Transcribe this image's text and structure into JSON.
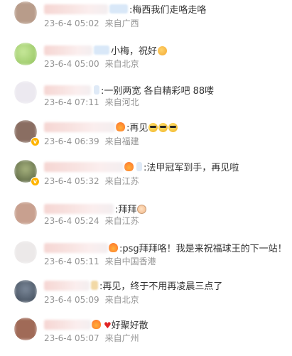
{
  "comments": [
    {
      "text": ":梅西我们走咯走咯",
      "date": "23-6-4 05:02",
      "location": "来自广西",
      "avatar_color": "#b89c8a"
    },
    {
      "text": "小梅，祝好",
      "date": "23-6-4 05:00",
      "location": "来自北京",
      "avatar_color": "#9fcf6a"
    },
    {
      "badge": "",
      "text": ":一别两宽 各自精彩吧 88喽",
      "date": "23-6-4 07:11",
      "location": "来自河北",
      "avatar_color": "#e6e3ec"
    },
    {
      "text": ":再见",
      "date": "23-6-4 06:39",
      "location": "来自福建",
      "avatar_color": "#8a6e62"
    },
    {
      "badge": "",
      "text": ":法甲冠军到手，再见啦",
      "date": "23-6-4 05:32",
      "location": "来自江苏",
      "avatar_color": "#6c7a4f"
    },
    {
      "text": ":拜拜",
      "date": "23-6-4 05:24",
      "location": "来自江苏",
      "avatar_color": "#c8a08f"
    },
    {
      "text": ":psg拜拜咯！我是来祝福球王的下一站！",
      "date": "23-6-4 05:11",
      "location": "来自中国香港",
      "avatar_color": "#e7e4e4"
    },
    {
      "text": ":再见，终于不用再凌晨三点了",
      "date": "23-6-4 05:09",
      "location": "来自北京",
      "avatar_color": "#4b5868"
    },
    {
      "text": "好聚好散",
      "date": "23-6-4 05:07",
      "location": "来自广州",
      "avatar_color": "#a06a57"
    }
  ],
  "colors": {
    "meta_text": "#939393",
    "comment_text": "#333333",
    "badge_bg": "#dfeaf7"
  },
  "icons": [
    "clapping-hands-emoji",
    "sunglasses-emoji",
    "fire-emoji",
    "red-heart-emoji",
    "waving-hand-emoji",
    "verified-badge-icon"
  ]
}
